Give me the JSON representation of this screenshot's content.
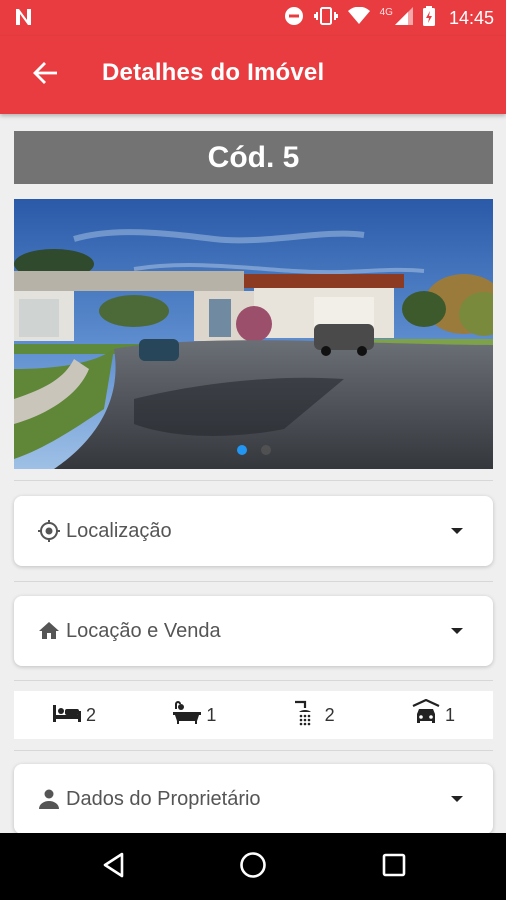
{
  "status_bar": {
    "time": "14:45",
    "network_label": "4G",
    "icons": [
      "n-logo-icon",
      "do-not-disturb-icon",
      "vibrate-icon",
      "wifi-icon",
      "signal-icon",
      "battery-charging-icon"
    ]
  },
  "app_bar": {
    "title": "Detalhes do Imóvel",
    "back_icon": "arrow-back-icon"
  },
  "property": {
    "code": "Cód. 5",
    "gallery": {
      "image_count": 2,
      "active_index": 0
    }
  },
  "sections": {
    "location": {
      "label": "Localização",
      "icon": "location-target-icon"
    },
    "rent_sale": {
      "label": "Locação e Venda",
      "icon": "home-icon"
    },
    "owner": {
      "label": "Dados do Proprietário",
      "icon": "person-icon"
    }
  },
  "features": {
    "bedrooms": {
      "icon": "bed-icon",
      "value": "2"
    },
    "bathtubs": {
      "icon": "bathtub-icon",
      "value": "1"
    },
    "showers": {
      "icon": "shower-icon",
      "value": "2"
    },
    "garage": {
      "icon": "car-icon",
      "value": "1"
    }
  },
  "colors": {
    "primary": "#e93c40",
    "code_bar": "#737373",
    "dot_active": "#2196f3",
    "background": "#efefef"
  },
  "nav_bar": {
    "icons": [
      "back-triangle-icon",
      "home-circle-icon",
      "recents-square-icon"
    ]
  }
}
